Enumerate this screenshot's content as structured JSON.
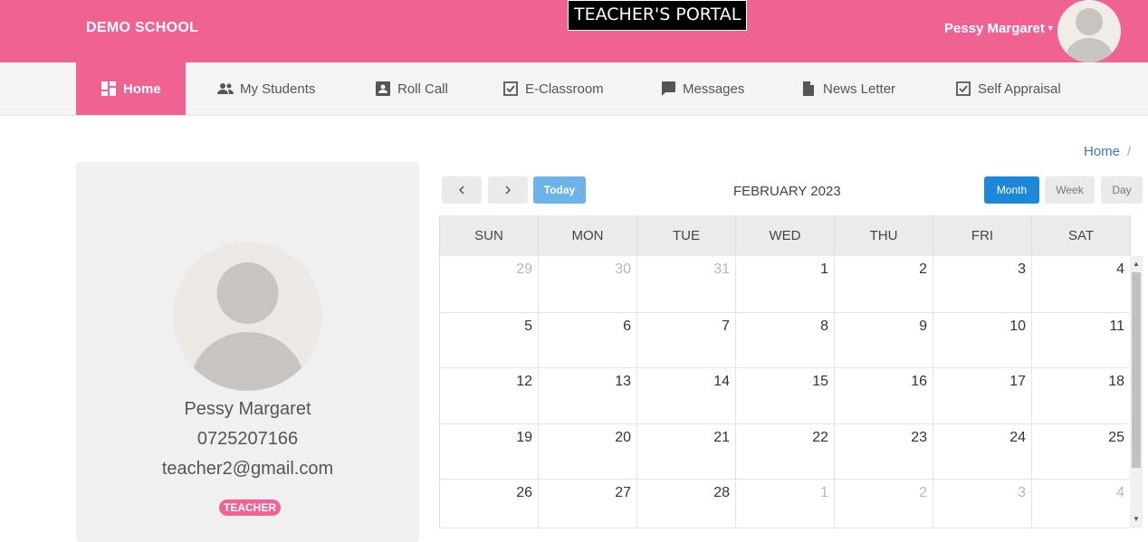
{
  "header": {
    "brand": "DEMO SCHOOL",
    "portal_title": "TEACHER'S PORTAL",
    "user_name": "Pessy Margaret",
    "accent_color": "#f06292"
  },
  "nav": {
    "items": [
      {
        "label": "Home",
        "icon": "dashboard-icon"
      },
      {
        "label": "My Students",
        "icon": "people-icon"
      },
      {
        "label": "Roll Call",
        "icon": "contact-card-icon"
      },
      {
        "label": "E-Classroom",
        "icon": "checkbox-icon"
      },
      {
        "label": "Messages",
        "icon": "chat-bubble-icon"
      },
      {
        "label": "News Letter",
        "icon": "document-icon"
      },
      {
        "label": "Self Appraisal",
        "icon": "checkbox-icon"
      }
    ],
    "active": "Home"
  },
  "breadcrumb": {
    "items": [
      "Home"
    ],
    "separator": "/"
  },
  "profile": {
    "name": "Pessy Margaret",
    "phone": "0725207166",
    "email": "teacher2@gmail.com",
    "role": "TEACHER"
  },
  "calendar": {
    "prev_icon": "chevron-left-icon",
    "next_icon": "chevron-right-icon",
    "today_label": "Today",
    "title": "FEBRUARY 2023",
    "views": [
      "Month",
      "Week",
      "Day"
    ],
    "active_view": "Month",
    "weekdays": [
      "SUN",
      "MON",
      "TUE",
      "WED",
      "THU",
      "FRI",
      "SAT"
    ],
    "weeks": [
      [
        {
          "d": "29",
          "o": true
        },
        {
          "d": "30",
          "o": true
        },
        {
          "d": "31",
          "o": true
        },
        {
          "d": "1"
        },
        {
          "d": "2"
        },
        {
          "d": "3"
        },
        {
          "d": "4"
        }
      ],
      [
        {
          "d": "5"
        },
        {
          "d": "6"
        },
        {
          "d": "7"
        },
        {
          "d": "8"
        },
        {
          "d": "9"
        },
        {
          "d": "10"
        },
        {
          "d": "11"
        }
      ],
      [
        {
          "d": "12"
        },
        {
          "d": "13"
        },
        {
          "d": "14"
        },
        {
          "d": "15"
        },
        {
          "d": "16"
        },
        {
          "d": "17"
        },
        {
          "d": "18"
        }
      ],
      [
        {
          "d": "19"
        },
        {
          "d": "20"
        },
        {
          "d": "21"
        },
        {
          "d": "22"
        },
        {
          "d": "23"
        },
        {
          "d": "24"
        },
        {
          "d": "25"
        }
      ],
      [
        {
          "d": "26"
        },
        {
          "d": "27"
        },
        {
          "d": "28"
        },
        {
          "d": "1",
          "o": true
        },
        {
          "d": "2",
          "o": true
        },
        {
          "d": "3",
          "o": true
        },
        {
          "d": "4",
          "o": true
        }
      ]
    ]
  }
}
